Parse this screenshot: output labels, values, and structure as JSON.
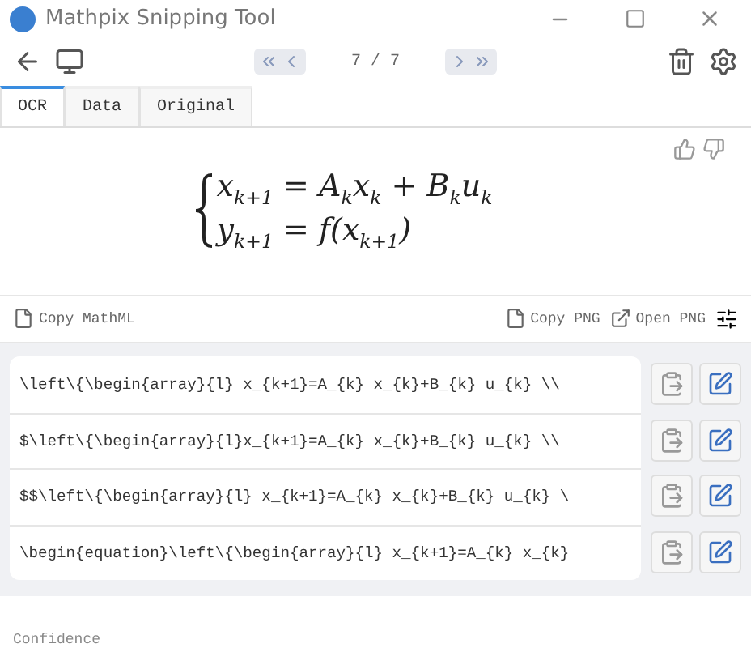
{
  "window": {
    "title": "Mathpix Snipping Tool"
  },
  "toolbar": {
    "page": "7 / 7"
  },
  "tabs": [
    {
      "label": "OCR",
      "selected": true
    },
    {
      "label": "Data",
      "selected": false
    },
    {
      "label": "Original",
      "selected": false
    }
  ],
  "preview": {
    "lines": [
      "x$_{k+1}$ = A$_{k}$x$_{k}$ + B$_{k}$u$_{k}$",
      "y$_{k+1}$ = f(x$_{k+1}$)"
    ]
  },
  "actions": {
    "left": "Copy MathML",
    "copy_png": "Copy PNG",
    "open_png": "Open PNG"
  },
  "results": [
    "\\left\\{\\begin{array}{l} x_{k+1}=A_{k} x_{k}+B_{k} u_{k} \\\\",
    "$\\left\\{\\begin{array}{l}x_{k+1}=A_{k} x_{k}+B_{k} u_{k} \\\\",
    "$$\\left\\{\\begin{array}{l} x_{k+1}=A_{k} x_{k}+B_{k} u_{k} \\",
    "\\begin{equation}\\left\\{\\begin{array}{l} x_{k+1}=A_{k} x_{k}"
  ],
  "confidence": {
    "label": "Confidence"
  }
}
